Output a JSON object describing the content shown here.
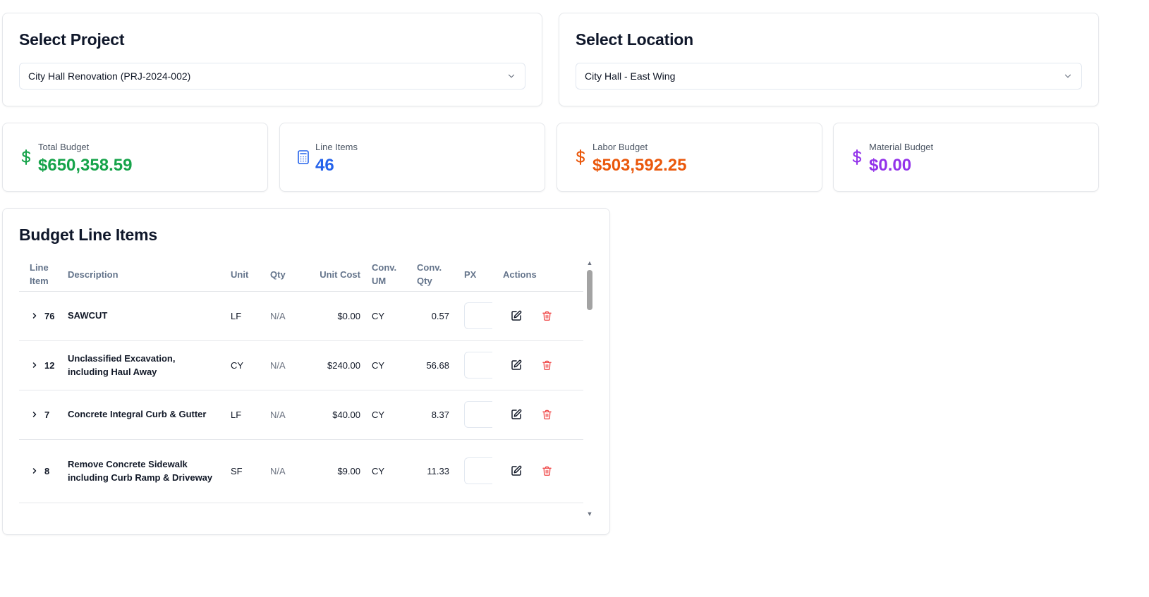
{
  "project_select": {
    "title": "Select Project",
    "value": "City Hall Renovation (PRJ-2024-002)"
  },
  "location_select": {
    "title": "Select Location",
    "value": "City Hall - East Wing"
  },
  "stats": [
    {
      "label": "Total Budget",
      "value": "$650,358.59",
      "icon": "dollar-icon",
      "color": "#16a34a"
    },
    {
      "label": "Line Items",
      "value": "46",
      "icon": "calculator-icon",
      "color": "#2563eb"
    },
    {
      "label": "Labor Budget",
      "value": "$503,592.25",
      "icon": "dollar-icon",
      "color": "#ea580c"
    },
    {
      "label": "Material Budget",
      "value": "$0.00",
      "icon": "dollar-icon",
      "color": "#9333ea"
    }
  ],
  "table": {
    "title": "Budget Line Items",
    "headers": {
      "line_item": "Line\nItem",
      "description": "Description",
      "unit": "Unit",
      "qty": "Qty",
      "unit_cost": "Unit Cost",
      "conv_um": "Conv.\nUM",
      "conv_qty": "Conv.\nQty",
      "px": "PX",
      "actions": "Actions"
    },
    "rows": [
      {
        "line": "76",
        "description": "SAWCUT",
        "unit": "LF",
        "qty": "N/A",
        "unit_cost": "$0.00",
        "conv_um": "CY",
        "conv_qty": "0.57",
        "px": ""
      },
      {
        "line": "12",
        "description": "Unclassified Excavation, including Haul Away",
        "unit": "CY",
        "qty": "N/A",
        "unit_cost": "$240.00",
        "conv_um": "CY",
        "conv_qty": "56.68",
        "px": ""
      },
      {
        "line": "7",
        "description": "Concrete Integral Curb & Gutter",
        "unit": "LF",
        "qty": "N/A",
        "unit_cost": "$40.00",
        "conv_um": "CY",
        "conv_qty": "8.37",
        "px": ""
      },
      {
        "line": "8",
        "description": "Remove Concrete Sidewalk including Curb Ramp & Driveway",
        "unit": "SF",
        "qty": "N/A",
        "unit_cost": "$9.00",
        "conv_um": "CY",
        "conv_qty": "11.33",
        "px": ""
      }
    ]
  },
  "colors": {
    "edit_icon": "#111827",
    "delete_icon": "#ef4444",
    "border": "#e5e7eb"
  }
}
